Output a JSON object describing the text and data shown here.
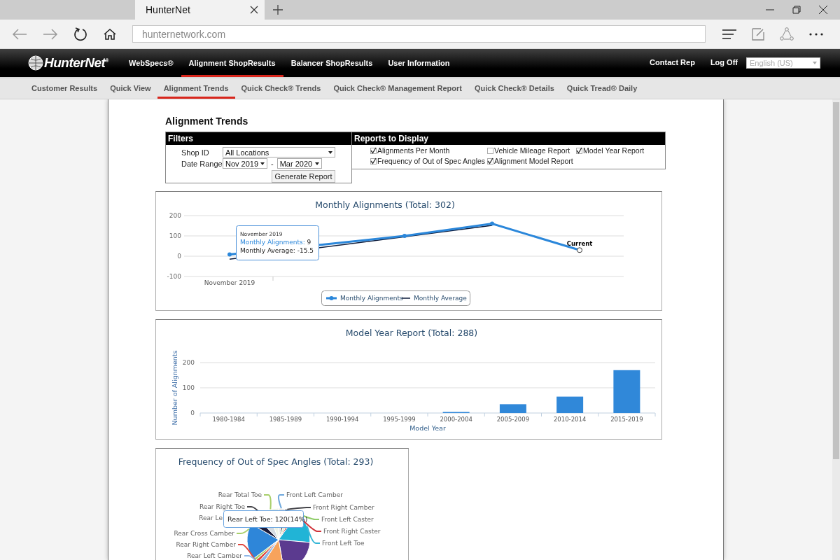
{
  "browser": {
    "tab_title": "HunterNet",
    "address": "hunternetwork.com"
  },
  "nav": {
    "logo": "HunterNet$^{®}$",
    "items": [
      {
        "label": "WebSpecs®",
        "selected": false
      },
      {
        "label": "Alignment ShopResults",
        "selected": true
      },
      {
        "label": "Balancer ShopResults",
        "selected": false
      },
      {
        "label": "User Information",
        "selected": false
      }
    ],
    "right_links": [
      "Contact Rep",
      "Log Off"
    ],
    "language": {
      "placeholder": "English (US)"
    }
  },
  "subnav": {
    "items": [
      {
        "label": "Customer Results",
        "selected": false
      },
      {
        "label": "Quick View",
        "selected": false
      },
      {
        "label": "Alignment Trends",
        "selected": true
      },
      {
        "label": "Quick Check® Trends",
        "selected": false
      },
      {
        "label": "Quick Check® Management Report",
        "selected": false
      },
      {
        "label": "Quick Check® Details",
        "selected": false
      },
      {
        "label": "Quick Tread® Daily",
        "selected": false
      }
    ]
  },
  "page": {
    "title": "Alignment Trends"
  },
  "filters": {
    "title": "Filters",
    "shop_id": {
      "label": "Shop ID",
      "value": "All Locations"
    },
    "date_range": {
      "label": "Date Range",
      "from": "Nov 2019",
      "separator": "-",
      "to": "Mar 2020"
    },
    "button": "Generate Report"
  },
  "reports": {
    "title": "Reports to Display",
    "options": [
      {
        "label": "Alignments Per Month",
        "checked": true
      },
      {
        "label": "Vehicle Mileage Report",
        "checked": false
      },
      {
        "label": "Model Year Report",
        "checked": true
      },
      {
        "label": "Frequency of Out of Spec Angles",
        "checked": true
      },
      {
        "label": "Alignment Model Report",
        "checked": true
      }
    ]
  },
  "monthly_chart": {
    "chart_data": {
      "type": "line",
      "title": "Monthly Alignments (Total: 302)",
      "ylim": [
        -100,
        200
      ],
      "yticks": [
        -100,
        0,
        100,
        200
      ],
      "legend": "bottom",
      "series": [
        {
          "name": "Monthly Alignments",
          "color": "#2b87da",
          "marker": true,
          "values": [
            9,
            null,
            100,
            160,
            30
          ]
        },
        {
          "name": "Monthly Average",
          "color": "#0d1b3a",
          "marker": false,
          "values": [
            -15,
            null,
            96,
            152,
            null
          ]
        }
      ]
    },
    "first_month_label": "November 2019",
    "current_label": "Current",
    "tooltip": {
      "title": "November 2019",
      "rows": [
        {
          "label": "Monthly Alignments:",
          "value": "9"
        },
        {
          "label": "Monthly Average:",
          "value": "-15.5"
        }
      ]
    }
  },
  "model_year_chart": {
    "chart_data": {
      "type": "bar",
      "title": "Model Year Report (Total: 288)",
      "xlabel": "Model Year",
      "ylabel": "Number of Alignments",
      "categories": [
        "1980-1984",
        "1985-1989",
        "1990-1994",
        "1995-1999",
        "2000-2004",
        "2005-2009",
        "2010-2014",
        "2015-2019"
      ],
      "values": [
        0,
        0,
        0,
        0,
        4,
        35,
        65,
        170
      ],
      "ylim": [
        0,
        200
      ],
      "yticks": [
        0,
        100,
        200
      ]
    }
  },
  "angles_chart": {
    "title": "Frequency of Out of Spec Angles (Total: 293)",
    "left_labels": [
      {
        "text": "Rear Total Toe",
        "color": "#a8cf6a"
      },
      {
        "text": "Rear Right Toe",
        "color": "#434348"
      },
      {
        "text": "Rear Le"
      },
      {
        "text": "Rear Cross Camber",
        "color": "#a8cf6a"
      },
      {
        "text": "Rear Right Camber",
        "color": "#e0463c"
      },
      {
        "text": "Rear Left Camber",
        "color": "#8cb6e8"
      }
    ],
    "right_labels": [
      {
        "text": "Front Left Camber",
        "color": "#6fa8dc"
      },
      {
        "text": "Front Right Camber",
        "color": "#434348"
      },
      {
        "text": "Front Left Caster",
        "color": "#90cd6a"
      },
      {
        "text": "Front Right Caster",
        "color": "#d0333a"
      },
      {
        "text": "Front Left Toe",
        "color": "#35b6d6"
      }
    ],
    "tooltip": "Rear Left Toe: 120(14%)"
  }
}
